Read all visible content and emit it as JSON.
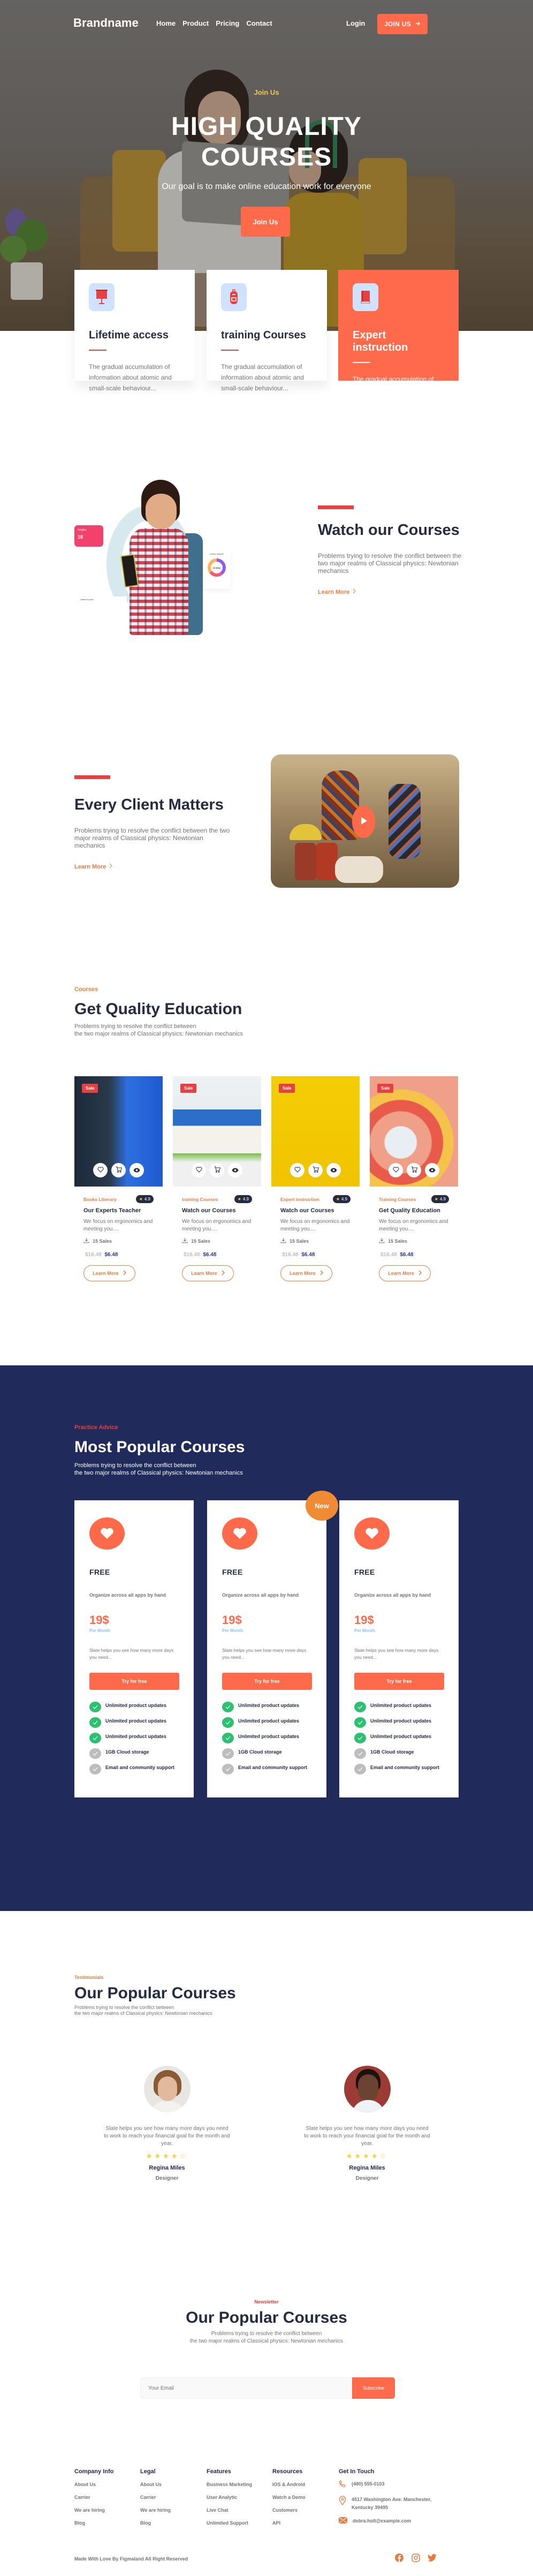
{
  "nav": {
    "brand": "Brandname",
    "links": [
      "Home",
      "Product",
      "Pricing",
      "Contact"
    ],
    "login": "Login",
    "join_label": "JOIN US"
  },
  "hero": {
    "eyebrow": "Join Us",
    "title_line1": "HIGH QUALITY",
    "title_line2": "COURSES",
    "description": "Our goal is to make online education work for everyone",
    "cta_label": "Join Us"
  },
  "features": [
    {
      "title": "Lifetime access",
      "text": "The gradual accumulation of information about atomic and small-scale behaviour...",
      "icon": "presentation-icon"
    },
    {
      "title": "training Courses",
      "text": "The gradual accumulation of information about atomic and small-scale behaviour...",
      "icon": "backpack-icon"
    },
    {
      "title": "Expert instruction",
      "text": "The gradual accumulation of information about atomic and small-scale behaviour...",
      "icon": "book-icon"
    }
  ],
  "watch": {
    "title": "Watch our Courses",
    "text": "Problems trying to resolve the conflict between the two major realms of Classical physics: Newtonian mechanics",
    "link": "Learn More",
    "illustration": {
      "singles_label": "Singles",
      "singles_value": "18",
      "global_label": "Global Statistic",
      "donut_label": "23 Wins",
      "scores_label": "Latest Scores"
    }
  },
  "client": {
    "title": "Every Client Matters",
    "text": "Problems trying to resolve the conflict between the two major realms of Classical physics: Newtonian mechanics",
    "link": "Learn More"
  },
  "courses": {
    "eyebrow": "Courses",
    "title": "Get Quality Education",
    "desc_line1": "Problems trying to resolve the conflict between",
    "desc_line2": "the two major realms of Classical physics: Newtonian mechanics",
    "items": [
      {
        "sale": "Sale",
        "category": "Books Liberary",
        "rating": "4.9",
        "title": "Our Experts Teacher",
        "desc": "We focus on ergonomics and meeting you....",
        "sales": "15 Sales",
        "old_price": "$16.48",
        "new_price": "$6.48",
        "cta": "Learn More"
      },
      {
        "sale": "Sale",
        "category": "training Courses",
        "rating": "4.9",
        "title": "Watch our Courses",
        "desc": "We focus on ergonomics and meeting you....",
        "sales": "15 Sales",
        "old_price": "$16.48",
        "new_price": "$6.48",
        "cta": "Learn More"
      },
      {
        "sale": "Sale",
        "category": "Expert instruction",
        "rating": "4.9",
        "title": "Watch our Courses",
        "desc": "We focus on ergonomics and meeting you....",
        "sales": "15 Sales",
        "old_price": "$16.48",
        "new_price": "$6.48",
        "cta": "Learn More"
      },
      {
        "sale": "Sale",
        "category": "Training Courses",
        "rating": "4.9",
        "title": "Get Quality Education",
        "desc": "We focus on ergonomics and meeting you....",
        "sales": "15 Sales",
        "old_price": "$16.48",
        "new_price": "$6.48",
        "cta": "Learn More"
      }
    ]
  },
  "pricing": {
    "eyebrow": "Practice Advice",
    "title": "Most Popular Courses",
    "desc_line1": "Problems trying to resolve the conflict between",
    "desc_line2": "the two major realms of Classical physics: Newtonian mechanics",
    "new_badge": "New",
    "plans": [
      {
        "name": "FREE",
        "tagline": "Organize across all apps by hand",
        "price": "19$",
        "period": "Per Month",
        "blurb": "Slate helps you see how many more days you need...",
        "cta": "Try for free",
        "features": [
          {
            "label": "Unlimited product updates",
            "included": true
          },
          {
            "label": "Unlimited product updates",
            "included": true
          },
          {
            "label": "Unlimited product updates",
            "included": true
          },
          {
            "label": "1GB  Cloud storage",
            "included": false
          },
          {
            "label": "Email and community support",
            "included": false
          }
        ]
      },
      {
        "name": "FREE",
        "tagline": "Organize across all apps by hand",
        "price": "19$",
        "period": "Per Month",
        "blurb": "Slate helps you see how many more days you need...",
        "cta": "Try for free",
        "features": [
          {
            "label": "Unlimited product updates",
            "included": true
          },
          {
            "label": "Unlimited product updates",
            "included": true
          },
          {
            "label": "Unlimited product updates",
            "included": true
          },
          {
            "label": "1GB  Cloud storage",
            "included": false
          },
          {
            "label": "Email and community support",
            "included": false
          }
        ]
      },
      {
        "name": "FREE",
        "tagline": "Organize across all apps by hand",
        "price": "19$",
        "period": "Per Month",
        "blurb": "Slate helps you see how many more days you need...",
        "cta": "Try for free",
        "features": [
          {
            "label": "Unlimited product updates",
            "included": true
          },
          {
            "label": "Unlimited product updates",
            "included": true
          },
          {
            "label": "Unlimited product updates",
            "included": true
          },
          {
            "label": "1GB  Cloud storage",
            "included": false
          },
          {
            "label": "Email and community support",
            "included": false
          }
        ]
      }
    ]
  },
  "testimonials": {
    "eyebrow": "Testimonials",
    "title": "Our Popular Courses",
    "desc_line1": "Problems trying to resolve the conflict between",
    "desc_line2": "the two major realms of Classical physics: Newtonian mechanics",
    "items": [
      {
        "quote": "Slate helps you see how many more days you need to work to reach your financial goal for the month and year.",
        "rating": 4,
        "rating_max": 5,
        "name": "Regina Miles",
        "role": "Designer"
      },
      {
        "quote": "Slate helps you see how many more days you need to work to reach your financial goal for the month and year.",
        "rating": 4,
        "rating_max": 5,
        "name": "Regina Miles",
        "role": "Designer"
      }
    ]
  },
  "newsletter": {
    "eyebrow": "Newsletter",
    "title": "Our Popular Courses",
    "desc_line1": "Problems trying to resolve the conflict between",
    "desc_line2": "the two major realms of Classical physics: Newtonian mechanics",
    "email_placeholder": "Your Email",
    "email_value": "",
    "subscribe_label": "Subscribe"
  },
  "footer": {
    "columns": [
      {
        "title": "Company Info",
        "links": [
          "About Us",
          "Carrier",
          "We are hiring",
          "Blog"
        ]
      },
      {
        "title": "Legal",
        "links": [
          "About Us",
          "Carrier",
          "We are hiring",
          "Blog"
        ]
      },
      {
        "title": "Features",
        "links": [
          "Business Marketing",
          "User Analytic",
          "Live Chat",
          "Unlimited Support"
        ]
      },
      {
        "title": "Resources",
        "links": [
          "IOS & Android",
          "Watch a Demo",
          "Customers",
          "API"
        ]
      }
    ],
    "contact": {
      "title": "Get In Touch",
      "phone": "(480) 555-0103",
      "address": "4517 Washington Ave. Manchester, Kentucky 39495",
      "email": "debra.holt@example.com"
    },
    "copyright": "Made With Love By Figmaland All Right Reserved",
    "socials": [
      "facebook-icon",
      "instagram-icon",
      "twitter-icon"
    ]
  },
  "colors": {
    "accent": "#FF6B4A",
    "navy": "#202A5B",
    "heading": "#252B42",
    "muted": "#737373",
    "success": "#2DC071",
    "badge_orange": "#F08A35",
    "star": "#FFCE31"
  }
}
